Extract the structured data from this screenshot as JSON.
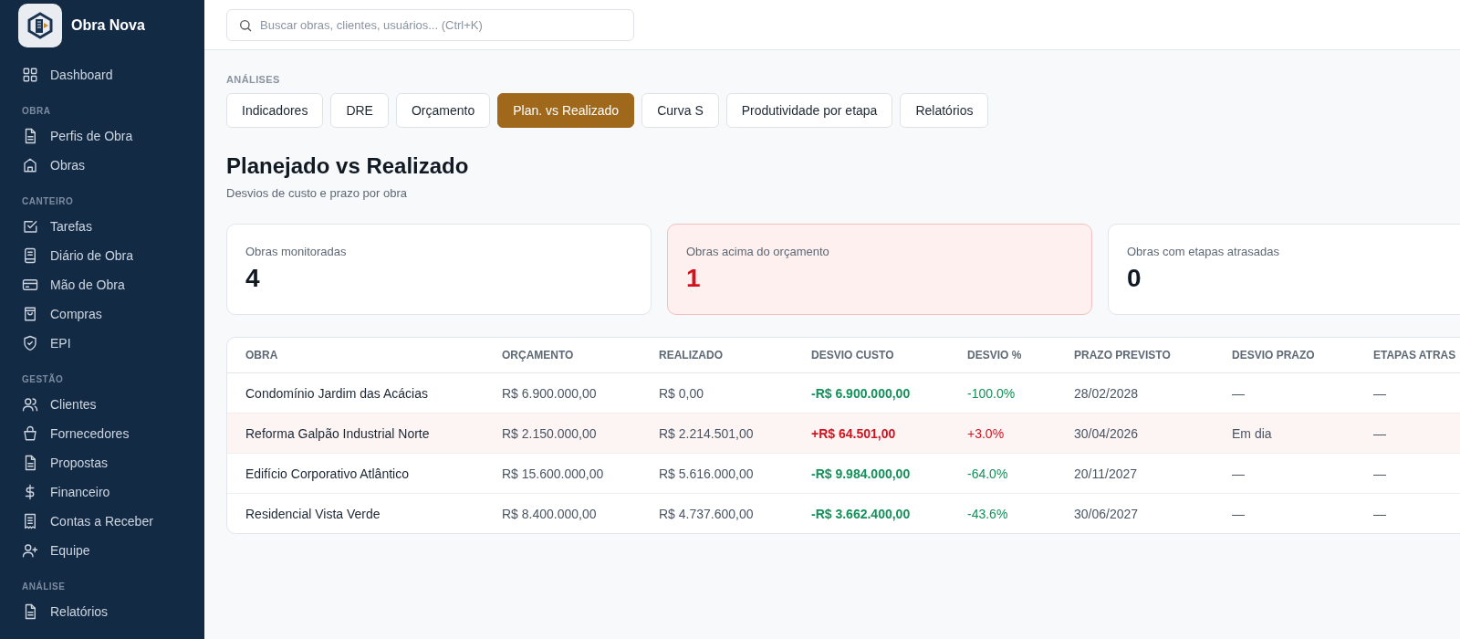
{
  "brand": {
    "name": "Obra Nova"
  },
  "sidebar": {
    "sections": [
      {
        "items": [
          {
            "label": "Dashboard",
            "selected": false
          }
        ]
      },
      {
        "title": "OBRA",
        "items": [
          {
            "label": "Perfis de Obra",
            "selected": false
          },
          {
            "label": "Obras",
            "selected": false
          }
        ]
      },
      {
        "title": "CANTEIRO",
        "items": [
          {
            "label": "Tarefas",
            "selected": false
          },
          {
            "label": "Diário de Obra",
            "selected": false
          },
          {
            "label": "Mão de Obra",
            "selected": false
          },
          {
            "label": "Compras",
            "selected": false
          },
          {
            "label": "EPI",
            "selected": false
          }
        ]
      },
      {
        "title": "GESTÃO",
        "items": [
          {
            "label": "Clientes",
            "selected": false
          },
          {
            "label": "Fornecedores",
            "selected": false
          },
          {
            "label": "Propostas",
            "selected": false
          },
          {
            "label": "Financeiro",
            "selected": false
          },
          {
            "label": "Contas a Receber",
            "selected": false
          },
          {
            "label": "Equipe",
            "selected": false
          }
        ]
      },
      {
        "title": "ANÁLISE",
        "items": [
          {
            "label": "Relatórios",
            "selected": false
          }
        ]
      }
    ]
  },
  "search": {
    "placeholder": "Buscar obras, clientes, usuários... (Ctrl+K)"
  },
  "section_label": "ANÁLISES",
  "tabs": [
    {
      "label": "Indicadores",
      "selected": false
    },
    {
      "label": "DRE",
      "selected": false
    },
    {
      "label": "Orçamento",
      "selected": false
    },
    {
      "label": "Plan. vs Realizado",
      "selected": true
    },
    {
      "label": "Curva S",
      "selected": false
    },
    {
      "label": "Produtividade por etapa",
      "selected": false
    },
    {
      "label": "Relatórios",
      "selected": false
    }
  ],
  "page": {
    "title": "Planejado vs Realizado",
    "subtitle": "Desvios de custo e prazo por obra"
  },
  "cards": [
    {
      "label": "Obras monitoradas",
      "value": "4",
      "alert": false
    },
    {
      "label": "Obras acima do orçamento",
      "value": "1",
      "alert": true
    },
    {
      "label": "Obras com etapas atrasadas",
      "value": "0",
      "alert": false
    }
  ],
  "table": {
    "columns": [
      "OBRA",
      "ORÇAMENTO",
      "REALIZADO",
      "DESVIO CUSTO",
      "DESVIO %",
      "PRAZO PREVISTO",
      "DESVIO PRAZO",
      "ETAPAS ATRAS"
    ],
    "rows": [
      {
        "over_budget": false,
        "cells": [
          "Condomínio Jardim das Acácias",
          "R$ 6.900.000,00",
          "R$ 0,00",
          "-R$ 6.900.000,00",
          "-100.0%",
          "28/02/2028",
          "—",
          "—"
        ]
      },
      {
        "over_budget": true,
        "cells": [
          "Reforma Galpão Industrial Norte",
          "R$ 2.150.000,00",
          "R$ 2.214.501,00",
          "+R$ 64.501,00",
          "+3.0%",
          "30/04/2026",
          "Em dia",
          "—"
        ]
      },
      {
        "over_budget": false,
        "cells": [
          "Edifício Corporativo Atlântico",
          "R$ 15.600.000,00",
          "R$ 5.616.000,00",
          "-R$ 9.984.000,00",
          "-64.0%",
          "20/11/2027",
          "—",
          "—"
        ]
      },
      {
        "over_budget": false,
        "cells": [
          "Residencial Vista Verde",
          "R$ 8.400.000,00",
          "R$ 4.737.600,00",
          "-R$ 3.662.400,00",
          "-43.6%",
          "30/06/2027",
          "—",
          "—"
        ]
      }
    ]
  }
}
